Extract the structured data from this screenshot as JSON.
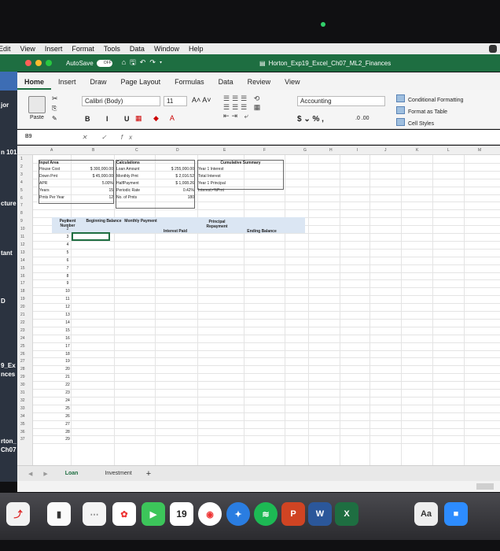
{
  "menubar": [
    "Edit",
    "View",
    "Insert",
    "Format",
    "Tools",
    "Data",
    "Window",
    "Help"
  ],
  "titlebar": {
    "autosave": "AutoSave",
    "toggle": "OFF",
    "doc_title": "Horton_Exp19_Excel_Ch07_ML2_Finances"
  },
  "tabs": [
    "Home",
    "Insert",
    "Draw",
    "Page Layout",
    "Formulas",
    "Data",
    "Review",
    "View"
  ],
  "ribbon": {
    "paste": "Paste",
    "font": "Calibri (Body)",
    "size": "11",
    "grow": "A˄ A˅",
    "format_buttons": "B I U",
    "number_format": "Accounting",
    "number_buttons": "$ ⌄ %  ,",
    "cond_format": "Conditional Formatting",
    "format_table": "Format as Table",
    "cell_styles": "Cell Styles"
  },
  "formula_bar": {
    "namebox": "B9",
    "fx": "✕ ✓ fx"
  },
  "columns": [
    "A",
    "B",
    "C",
    "D",
    "E",
    "F",
    "G",
    "H",
    "I",
    "J",
    "K",
    "L",
    "M"
  ],
  "rows": [
    "1",
    "2",
    "3",
    "4",
    "5",
    "6",
    "7",
    "8",
    "9",
    "10",
    "11",
    "12",
    "13",
    "14",
    "15",
    "16",
    "17",
    "18",
    "19",
    "20",
    "21",
    "22",
    "23",
    "24",
    "25",
    "26",
    "27",
    "28",
    "29",
    "30",
    "31",
    "32",
    "33",
    "34",
    "35",
    "36",
    "37"
  ],
  "input_area": {
    "title": "Input Area",
    "labels": [
      "House Cost",
      "Down Pmt",
      "APR",
      "Years",
      "Pmts Per Year"
    ],
    "values": [
      "$ 300,000.00",
      "$ 45,000.00",
      "5.00%",
      "15",
      "12"
    ]
  },
  "calculations": {
    "title": "Calculations",
    "labels": [
      "Loan Amount",
      "Monthly Pmt",
      "HalfPayment",
      "Periodic Rate",
      "No. of Pmts"
    ],
    "values": [
      "$ 255,000.00",
      "$ 2,016.52",
      "$ 1,008.26",
      "0.42%",
      "180"
    ]
  },
  "cumulative": {
    "title": "Cumulative Summary",
    "labels": [
      "Year 1 Interest",
      "Total Interest",
      "Year 1 Principal",
      "Interest>%Pmt"
    ]
  },
  "table_headers": {
    "payment_number": "Payment Number",
    "beginning_balance": "Beginning Balance",
    "monthly_payment": "Monthly Payment",
    "interest_paid": "Interest Paid",
    "principal_repayment": "Principal Repayment",
    "ending_balance": "Ending Balance"
  },
  "payment_numbers": [
    "1",
    "2",
    "3",
    "4",
    "5",
    "6",
    "7",
    "8",
    "9",
    "10",
    "11",
    "12",
    "13",
    "14",
    "15",
    "16",
    "17",
    "18",
    "19",
    "20",
    "21",
    "22",
    "23",
    "24",
    "25",
    "26",
    "27",
    "28",
    "29"
  ],
  "sheets": {
    "nav": "◀ ▶",
    "loan": "Loan",
    "investment": "Investment",
    "add": "+"
  },
  "side_labels": [
    "jor",
    "n 101",
    "cture",
    "tant",
    "D",
    "9_Ex",
    "nces",
    "rton_",
    "Ch07"
  ],
  "dock": {
    "calendar_day": "19",
    "word": "W",
    "excel": "X",
    "font_book": "Aa",
    "powerpoint": "P"
  }
}
